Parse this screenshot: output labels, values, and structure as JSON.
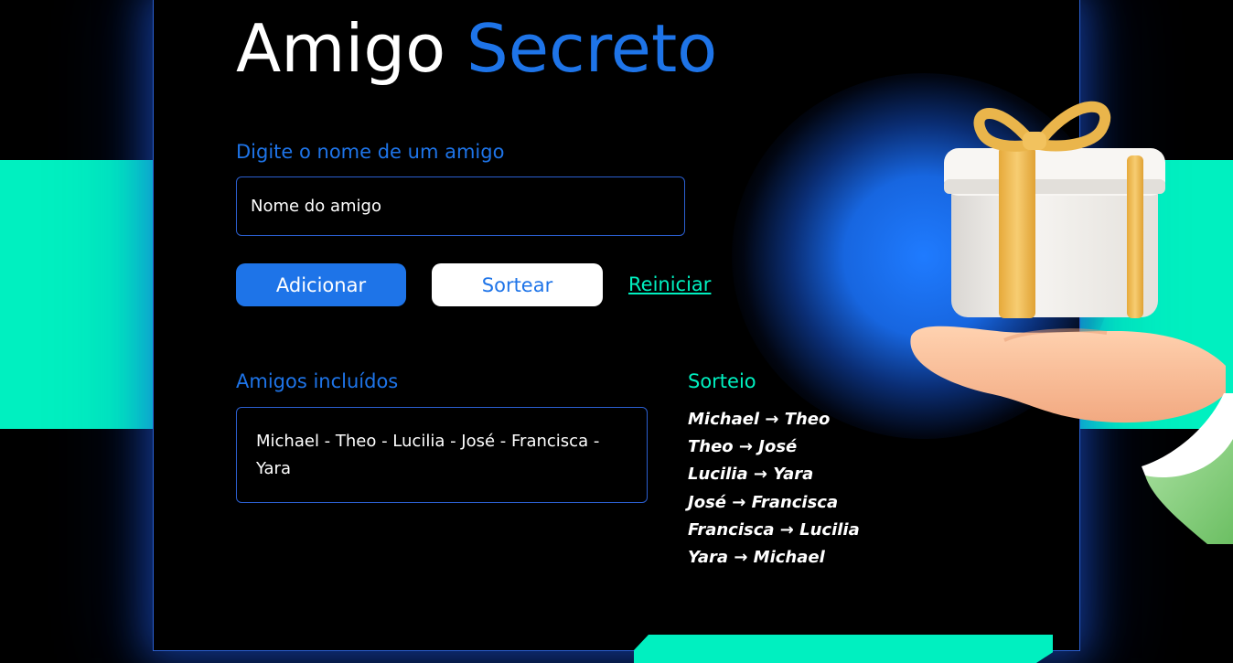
{
  "header": {
    "title_main": "Amigo",
    "title_accent": "Secreto"
  },
  "form": {
    "label": "Digite o nome de um amigo",
    "input_placeholder": "Nome do amigo",
    "input_value": ""
  },
  "actions": {
    "add_label": "Adicionar",
    "draw_label": "Sortear",
    "reset_label": "Reiniciar"
  },
  "friends": {
    "title": "Amigos incluídos",
    "list_text": "Michael - Theo - Lucilia - José - Francisca - Yara"
  },
  "draw": {
    "title": "Sorteio",
    "results": [
      "Michael → Theo",
      "Theo → José",
      "Lucilia → Yara",
      "José → Francisca",
      "Francisca → Lucilia",
      "Yara → Michael"
    ]
  },
  "illustration": {
    "icon": "gift-in-hand-icon"
  },
  "colors": {
    "background": "#000000",
    "primary_blue": "#1e74e8",
    "accent_teal": "#00f0c0",
    "border_blue": "#2b5fd0",
    "text": "#ffffff"
  }
}
